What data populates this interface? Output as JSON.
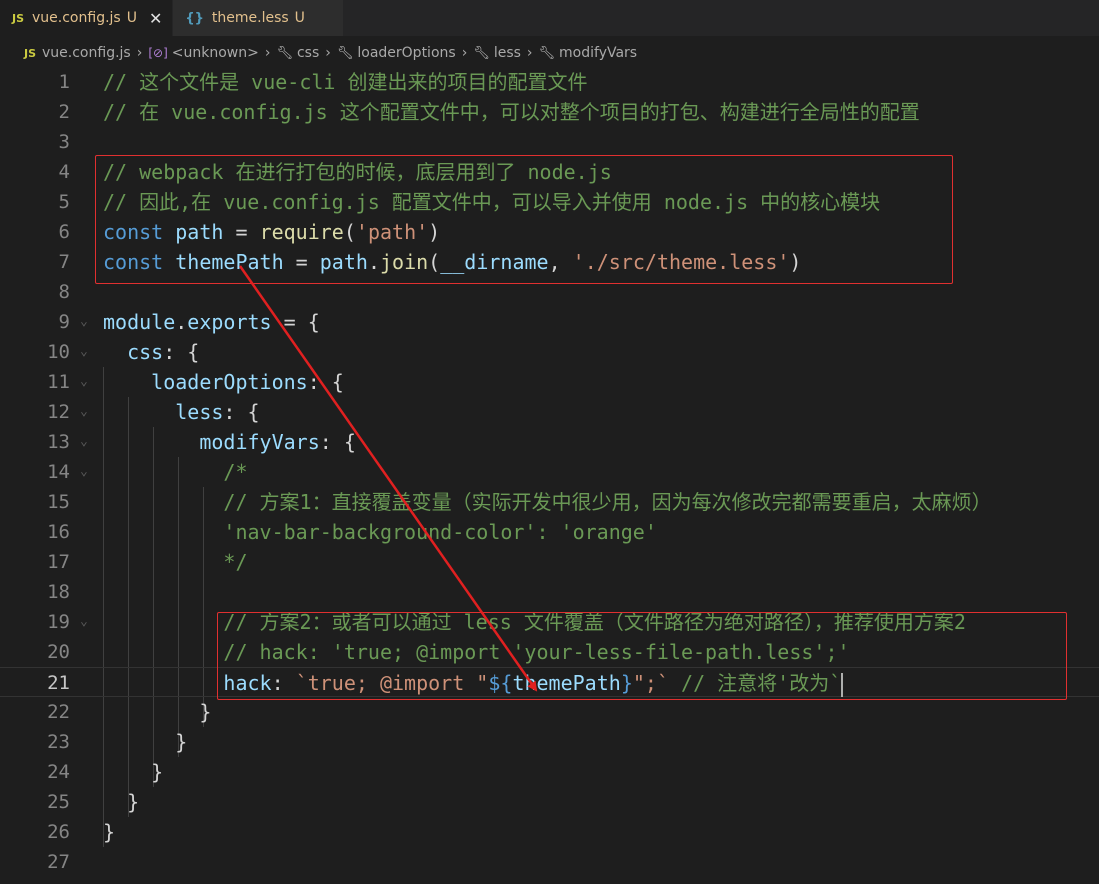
{
  "tabs": [
    {
      "badge": "JS",
      "label": "vue.config.js",
      "status": "U",
      "close": "✕"
    },
    {
      "badge": "{}",
      "label": "theme.less",
      "status": "U"
    }
  ],
  "breadcrumbs": [
    "vue.config.js",
    "<unknown>",
    "css",
    "loaderOptions",
    "less",
    "modifyVars"
  ],
  "breadcrumb_badge": "JS",
  "current_line": 21,
  "lines": [
    [
      {
        "t": "// 这个文件是 vue-cli 创建出来的项目的配置文件",
        "c": "c"
      }
    ],
    [
      {
        "t": "// 在 vue.config.js 这个配置文件中，可以对整个项目的打包、构建进行全局性的配置",
        "c": "c"
      }
    ],
    [],
    [
      {
        "t": "// webpack 在进行打包的时候，底层用到了 node.js",
        "c": "c"
      }
    ],
    [
      {
        "t": "// 因此,在 vue.config.js 配置文件中，可以导入并使用 node.js 中的核心模块",
        "c": "c"
      }
    ],
    [
      {
        "t": "const",
        "c": "k"
      },
      {
        "t": " ",
        "c": "p"
      },
      {
        "t": "path",
        "c": "v"
      },
      {
        "t": " = ",
        "c": "p"
      },
      {
        "t": "require",
        "c": "f"
      },
      {
        "t": "(",
        "c": "p"
      },
      {
        "t": "'path'",
        "c": "s"
      },
      {
        "t": ")",
        "c": "p"
      }
    ],
    [
      {
        "t": "const",
        "c": "k"
      },
      {
        "t": " ",
        "c": "p"
      },
      {
        "t": "themePath",
        "c": "v"
      },
      {
        "t": " = ",
        "c": "p"
      },
      {
        "t": "path",
        "c": "v"
      },
      {
        "t": ".",
        "c": "p"
      },
      {
        "t": "join",
        "c": "f"
      },
      {
        "t": "(",
        "c": "p"
      },
      {
        "t": "__dirname",
        "c": "v"
      },
      {
        "t": ", ",
        "c": "p"
      },
      {
        "t": "'./src/theme.less'",
        "c": "s"
      },
      {
        "t": ")",
        "c": "p"
      }
    ],
    [],
    [
      {
        "t": "module",
        "c": "v"
      },
      {
        "t": ".",
        "c": "p"
      },
      {
        "t": "exports",
        "c": "v"
      },
      {
        "t": " = {",
        "c": "p"
      }
    ],
    [
      {
        "t": "  ",
        "c": "p"
      },
      {
        "t": "css",
        "c": "v"
      },
      {
        "t": ": {",
        "c": "p"
      }
    ],
    [
      {
        "t": "    ",
        "c": "p"
      },
      {
        "t": "loaderOptions",
        "c": "v"
      },
      {
        "t": ": {",
        "c": "p"
      }
    ],
    [
      {
        "t": "      ",
        "c": "p"
      },
      {
        "t": "less",
        "c": "v"
      },
      {
        "t": ": {",
        "c": "p"
      }
    ],
    [
      {
        "t": "        ",
        "c": "p"
      },
      {
        "t": "modifyVars",
        "c": "v"
      },
      {
        "t": ": {",
        "c": "p"
      }
    ],
    [
      {
        "t": "          /*",
        "c": "c"
      }
    ],
    [
      {
        "t": "          // 方案1：直接覆盖变量（实际开发中很少用，因为每次修改完都需要重启，太麻烦）",
        "c": "c"
      }
    ],
    [
      {
        "t": "          'nav-bar-background-color': 'orange'",
        "c": "c"
      }
    ],
    [
      {
        "t": "          */",
        "c": "c"
      }
    ],
    [],
    [
      {
        "t": "          // 方案2：或者可以通过 less 文件覆盖（文件路径为绝对路径），推荐使用方案2",
        "c": "c"
      }
    ],
    [
      {
        "t": "          // hack: 'true; @import 'your-less-file-path.less';'",
        "c": "c"
      }
    ],
    [
      {
        "t": "          ",
        "c": "p"
      },
      {
        "t": "hack",
        "c": "v"
      },
      {
        "t": ": ",
        "c": "p"
      },
      {
        "t": "`true; @import \"",
        "c": "s"
      },
      {
        "t": "${",
        "c": "k"
      },
      {
        "t": "themePath",
        "c": "v"
      },
      {
        "t": "}",
        "c": "k"
      },
      {
        "t": "\";`",
        "c": "s"
      },
      {
        "t": " // 注意将'改为`",
        "c": "c"
      }
    ],
    [
      {
        "t": "        }",
        "c": "p"
      }
    ],
    [
      {
        "t": "      }",
        "c": "p"
      }
    ],
    [
      {
        "t": "    }",
        "c": "p"
      }
    ],
    [
      {
        "t": "  }",
        "c": "p"
      }
    ],
    [
      {
        "t": "}",
        "c": "p"
      }
    ],
    []
  ]
}
